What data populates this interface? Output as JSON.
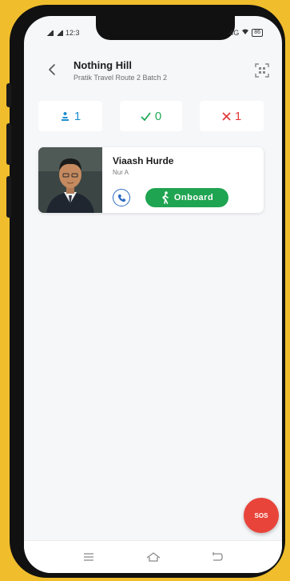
{
  "status_bar": {
    "time": "12:3",
    "battery": "86",
    "network_label": "4G"
  },
  "header": {
    "title": "Nothing Hill",
    "subtitle": "Pratik Travel Route 2 Batch 2"
  },
  "counts": {
    "total": "1",
    "onboard": "0",
    "absent": "1"
  },
  "passengers": [
    {
      "name": "Viaash Hurde",
      "detail": "Nur A",
      "status": "Onboard"
    }
  ],
  "sos": {
    "label": "SOS"
  },
  "colors": {
    "background": "#f0bd2d",
    "total_color": "#1f8fd0",
    "onboard_color": "#21a957",
    "absent_color": "#e23c3c",
    "onboard_button": "#1fa451",
    "sos_button": "#e8443a"
  },
  "icons": {
    "back": "back-arrow-icon",
    "scan": "qr-scan-icon",
    "total": "passengers-icon",
    "onboard": "check-icon",
    "absent": "cross-icon",
    "call": "phone-icon",
    "walk": "walking-person-icon",
    "nav_menu": "menu-icon",
    "nav_home": "home-icon",
    "nav_back": "back-icon"
  }
}
